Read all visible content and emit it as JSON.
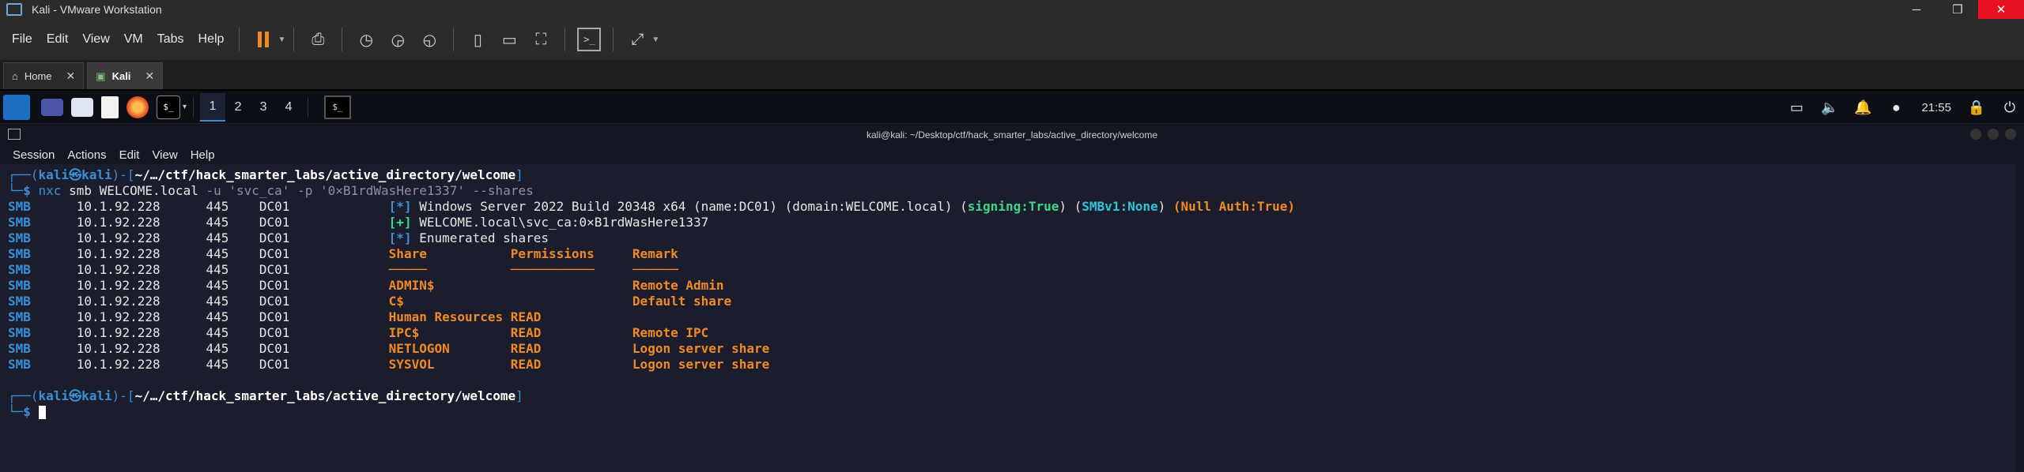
{
  "vmware": {
    "title": "Kali - VMware Workstation",
    "menu": [
      "File",
      "Edit",
      "View",
      "VM",
      "Tabs",
      "Help"
    ],
    "tabs": [
      {
        "label": "Home",
        "active": false
      },
      {
        "label": "Kali",
        "active": true
      }
    ]
  },
  "kali_panel": {
    "workspaces": [
      "1",
      "2",
      "3",
      "4"
    ],
    "active_workspace": "1",
    "clock": "21:55"
  },
  "terminal": {
    "window_title": "kali@kali: ~/Desktop/ctf/hack_smarter_labs/active_directory/welcome",
    "menu": [
      "Session",
      "Actions",
      "Edit",
      "View",
      "Help"
    ],
    "prompt_user": "kali",
    "prompt_host": "kali",
    "prompt_path": "~/…/ctf/hack_smarter_labs/active_directory/welcome",
    "command": {
      "prog": "nxc",
      "args": " smb WELCOME.local ",
      "flag_u": "-u",
      "user": "'svc_ca'",
      "flag_p": "-p",
      "pass": "'0×B1rdWasHere1337'",
      "flag_shares": "--shares"
    },
    "out_prefix": {
      "proto": "SMB",
      "ip": "10.1.92.228",
      "port": "445",
      "host": "DC01"
    },
    "info_line": {
      "tag": "[*]",
      "text": "Windows Server 2022 Build 20348 x64 (name:DC01) (domain:WELCOME.local) (",
      "signing": "signing:True",
      "sep1": ") (",
      "smbv1": "SMBv1:None",
      "sep2": ") ",
      "null_auth": "(Null Auth:True)"
    },
    "auth_line": {
      "tag": "[+]",
      "text": "WELCOME.local\\svc_ca:0×B1rdWasHere1337"
    },
    "enum_line": {
      "tag": "[*]",
      "text": "Enumerated shares"
    },
    "shares_header": {
      "share": "Share",
      "permissions": "Permissions",
      "remark": "Remark"
    },
    "shares_underline": {
      "share": "─────",
      "permissions": "───────────",
      "remark": "──────"
    },
    "shares": [
      {
        "share": "ADMIN$",
        "permissions": "",
        "remark": "Remote Admin"
      },
      {
        "share": "C$",
        "permissions": "",
        "remark": "Default share"
      },
      {
        "share": "Human Resources",
        "permissions": "READ",
        "remark": ""
      },
      {
        "share": "IPC$",
        "permissions": "READ",
        "remark": "Remote IPC"
      },
      {
        "share": "NETLOGON",
        "permissions": "READ",
        "remark": "Logon server share"
      },
      {
        "share": "SYSVOL",
        "permissions": "READ",
        "remark": "Logon server share"
      }
    ]
  }
}
